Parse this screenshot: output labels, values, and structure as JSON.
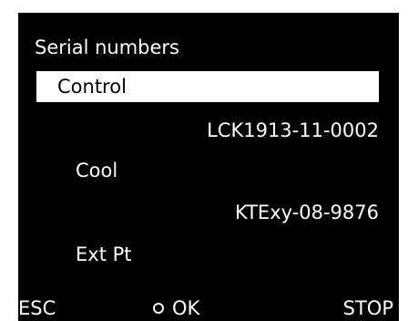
{
  "screen": {
    "title": "Serial numbers",
    "items": [
      {
        "label": "Control",
        "serial": "LCK1913-11-0002",
        "selected": true
      },
      {
        "label": "Cool",
        "serial": "KTExy-08-9876",
        "selected": false
      },
      {
        "label": "Ext Pt",
        "serial": "",
        "selected": false
      }
    ]
  },
  "softkeys": {
    "esc": "ESC",
    "ok": "OK",
    "stop": "STOP"
  },
  "colors": {
    "background": "#000000",
    "foreground": "#ffffff",
    "highlight_bg": "#ffffff",
    "highlight_fg": "#000000"
  }
}
